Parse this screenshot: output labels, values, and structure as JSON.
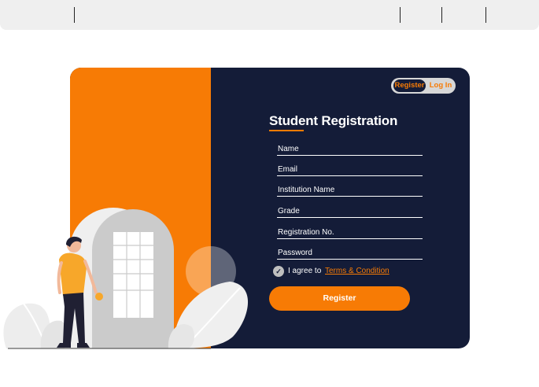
{
  "colors": {
    "accent": "#f77b05",
    "panel": "#141c38",
    "topbar": "#efefef"
  },
  "auth_toggle": {
    "register_label": "Register",
    "login_label": "Log In"
  },
  "form": {
    "title": "Student Registration",
    "fields": [
      {
        "label": "Name"
      },
      {
        "label": "Email"
      },
      {
        "label": "Institution Name"
      },
      {
        "label": "Grade"
      },
      {
        "label": "Registration No."
      },
      {
        "label": "Password"
      }
    ],
    "agree_text": "I agree to",
    "terms_link": "Terms & Condition",
    "submit_label": "Register"
  },
  "icons": {
    "checkbox": "check-circle-icon"
  }
}
